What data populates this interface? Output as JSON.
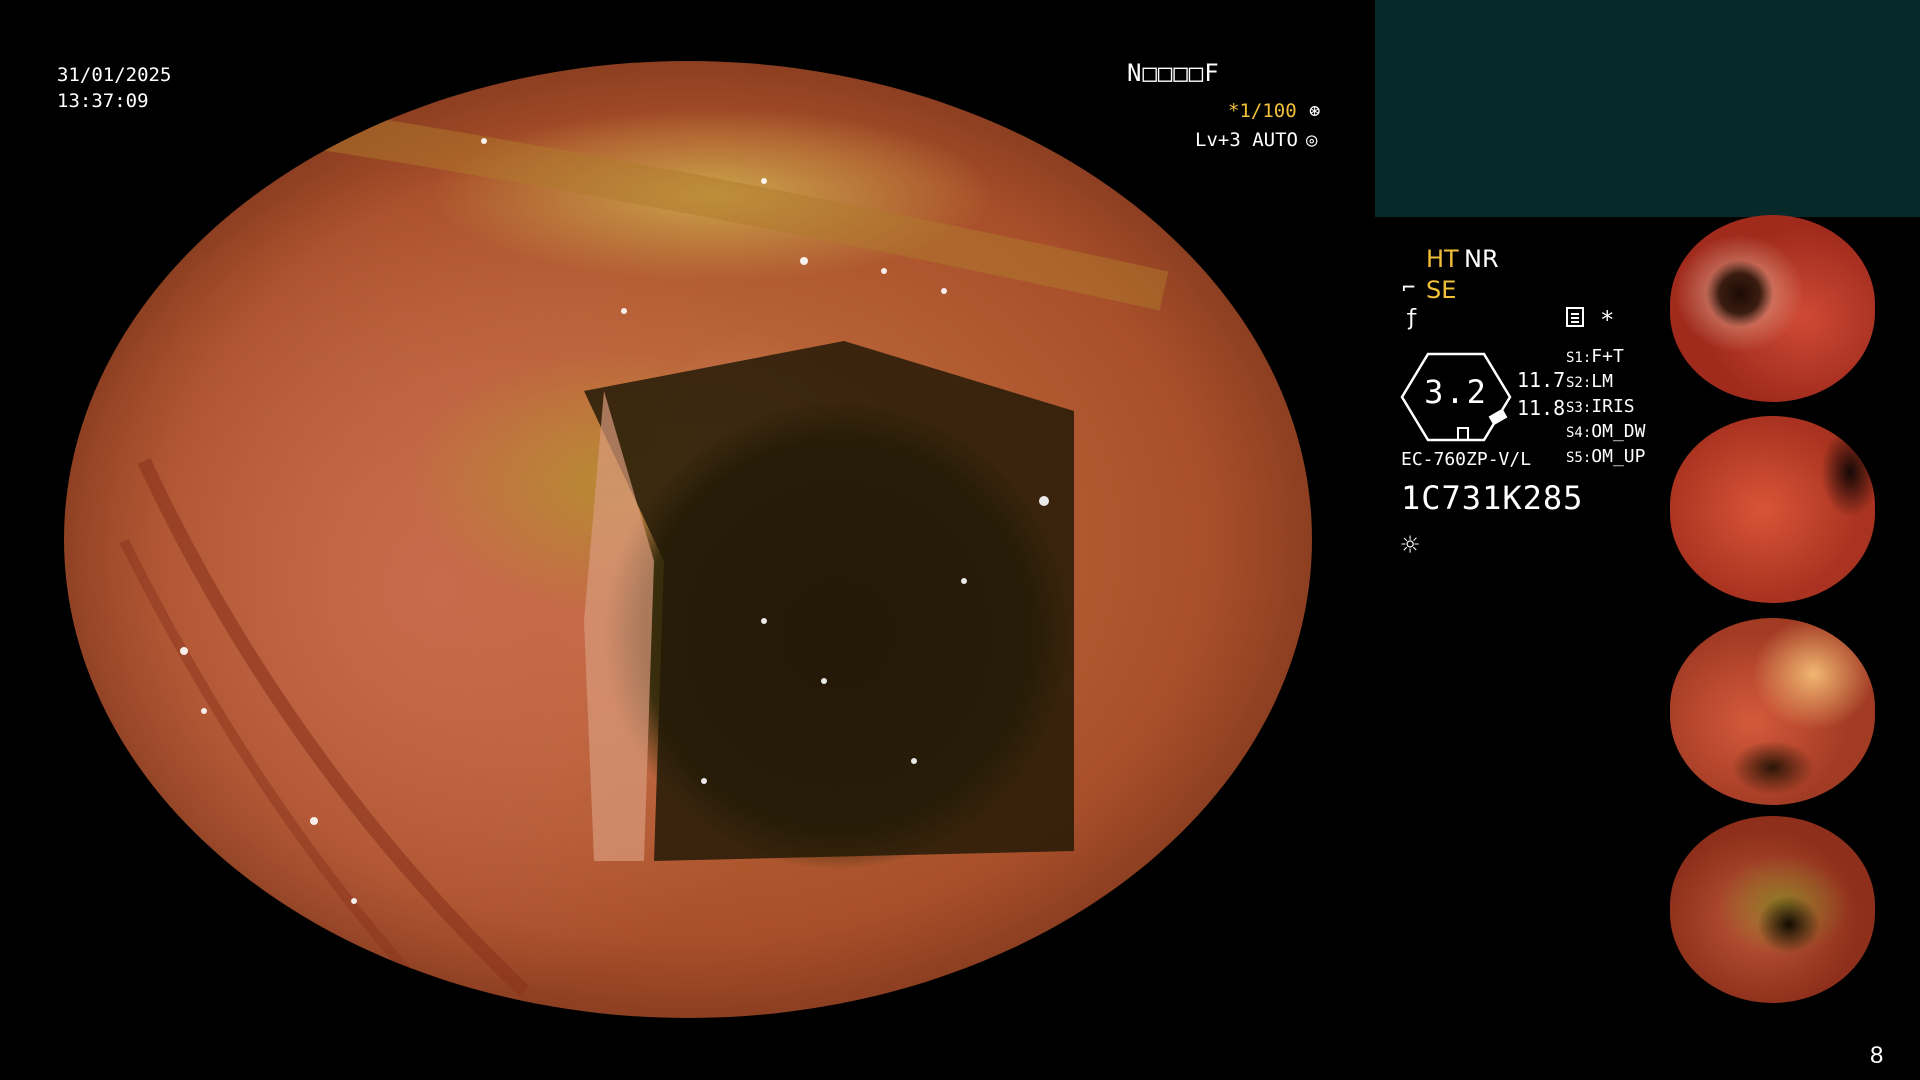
{
  "overlay": {
    "date": "31/01/2025",
    "time": "13:37:09",
    "patient_code": "N□□□□F",
    "shutter": "*1/100",
    "level": "Lv+3 AUTO"
  },
  "status": {
    "ht": "HT",
    "nr": "NR",
    "se": "SE",
    "gauge_value": "3.2",
    "value_a": "11.7",
    "value_b": "11.8",
    "scope_model": "EC-760ZP-V/L",
    "serial": "1C731K285"
  },
  "settings": [
    {
      "key": "S1:",
      "value": "F+T"
    },
    {
      "key": "S2:",
      "value": "LM"
    },
    {
      "key": "S3:",
      "value": "IRIS"
    },
    {
      "key": "S4:",
      "value": "OM_DW"
    },
    {
      "key": "S5:",
      "value": "OM_UP"
    }
  ],
  "icons": {
    "shutter": "aperture-icon",
    "level": "iris-icon",
    "se": "structure-enhancement-icon",
    "f": "filter-icon",
    "record": "record-icon",
    "star": "asterisk-icon",
    "light": "light-icon"
  },
  "colors": {
    "accent": "#f2c038",
    "panel": "#06292a"
  },
  "page_number": "8"
}
